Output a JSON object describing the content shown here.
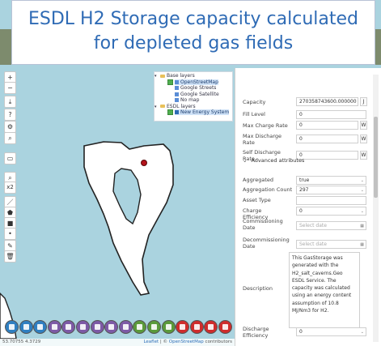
{
  "banner": {
    "line1": "ESDL H2 Storage capacity calculated",
    "line2": "for depleted gas fields"
  },
  "toolbar": {
    "zoom_in": "+",
    "zoom_out": "−",
    "zoom_badge": "x2"
  },
  "layers": {
    "base_group": "Base layers",
    "items": [
      "OpenStreetMap",
      "Google Streets",
      "Google Satellite",
      "No map"
    ],
    "esdl_group": "ESDL layers",
    "esdl_item": "New Energy System"
  },
  "panel": {
    "capacity_label": "Capacity",
    "capacity_value": "270358743600.000000",
    "capacity_unit": "J",
    "fill_level_label": "Fill Level",
    "fill_level_value": "0",
    "max_charge_label": "Max Charge Rate",
    "max_charge_value": "0",
    "max_charge_unit": "W",
    "max_discharge_label": "Max Discharge Rate",
    "max_discharge_value": "0",
    "max_discharge_unit": "W",
    "self_discharge_label": "Self Discharge Rate",
    "self_discharge_value": "0",
    "section_title": "Advanced attributes",
    "aggregated_label": "Aggregated",
    "aggregated_value": "true",
    "aggregation_count_label": "Aggregation Count",
    "aggregation_count_value": "297",
    "asset_type_label": "Asset Type",
    "asset_type_value": "",
    "charge_eff_label": "Charge Efficiency",
    "charge_eff_value": "0",
    "commissioning_label": "Commissioning Date",
    "commissioning_placeholder": "Select date",
    "decommissioning_label": "Decommissioning Date",
    "decommissioning_placeholder": "Select date",
    "description_label": "Description",
    "description_value": "This GasStorage was generated with the H2_salt_caverns.Geo ESDL Service. The capacity was calculated using an energy content assumption of 10.8 MJ/Nm3 for H2.",
    "discharge_eff_label": "Discharge Efficiency",
    "discharge_eff_value": "0"
  },
  "status": {
    "coords": "53.70755 4.3729",
    "leaflet": "Leaflet",
    "sep": " | © ",
    "osm": "OpenStreetMap",
    "contributors": " contributors"
  },
  "colors": {
    "water": "#aad3df",
    "land": "#ffffff",
    "banner_text": "#2f6bb5",
    "marker": "#b3131a"
  },
  "bottom_icons": [
    {
      "name": "globe-icon",
      "color": "#2f7fc1"
    },
    {
      "name": "turbine-icon",
      "color": "#2f7fc1"
    },
    {
      "name": "turbine-park-icon",
      "color": "#2f7fc1"
    },
    {
      "name": "drill-icon",
      "color": "#7d5aa6"
    },
    {
      "name": "grid-icon",
      "color": "#7d5aa6"
    },
    {
      "name": "battery-icon",
      "color": "#7d5aa6"
    },
    {
      "name": "storage-icon",
      "color": "#7d5aa6"
    },
    {
      "name": "tank-icon",
      "color": "#7d5aa6"
    },
    {
      "name": "factory-icon",
      "color": "#7d5aa6"
    },
    {
      "name": "house-icon",
      "color": "#5a9a3a"
    },
    {
      "name": "solar-icon",
      "color": "#5a9a3a"
    },
    {
      "name": "bolt-icon",
      "color": "#5a9a3a"
    },
    {
      "name": "transformer-icon",
      "color": "#cf2c2c"
    },
    {
      "name": "heat-pump-icon",
      "color": "#cf2c2c"
    },
    {
      "name": "boiler-icon",
      "color": "#cf2c2c"
    },
    {
      "name": "gas-icon",
      "color": "#cf2c2c"
    }
  ]
}
